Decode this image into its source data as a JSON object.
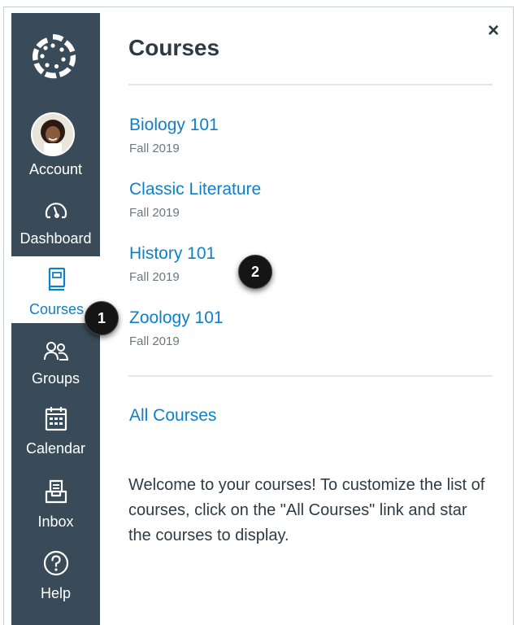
{
  "colors": {
    "nav_background": "#394b58",
    "link": "#0e80c7",
    "heading": "#2d3b45",
    "muted": "#6b7780",
    "divider": "#e4e6e8"
  },
  "global_nav": {
    "items": [
      {
        "label": "Account",
        "icon": "avatar"
      },
      {
        "label": "Dashboard",
        "icon": "speedometer-icon"
      },
      {
        "label": "Courses",
        "icon": "book-icon",
        "active": true
      },
      {
        "label": "Groups",
        "icon": "users-icon"
      },
      {
        "label": "Calendar",
        "icon": "calendar-icon"
      },
      {
        "label": "Inbox",
        "icon": "inbox-icon"
      },
      {
        "label": "Help",
        "icon": "question-icon"
      }
    ]
  },
  "tray": {
    "title": "Courses",
    "close_label": "×",
    "courses": [
      {
        "name": "Biology 101",
        "term": "Fall 2019"
      },
      {
        "name": "Classic Literature",
        "term": "Fall 2019"
      },
      {
        "name": "History 101",
        "term": "Fall 2019"
      },
      {
        "name": "Zoology 101",
        "term": "Fall 2019"
      }
    ],
    "all_courses_label": "All Courses",
    "welcome_text": "Welcome to your courses! To customize the list of courses, click on the \"All Courses\" link and star the courses to display."
  },
  "callouts": [
    {
      "number": "1"
    },
    {
      "number": "2"
    }
  ]
}
